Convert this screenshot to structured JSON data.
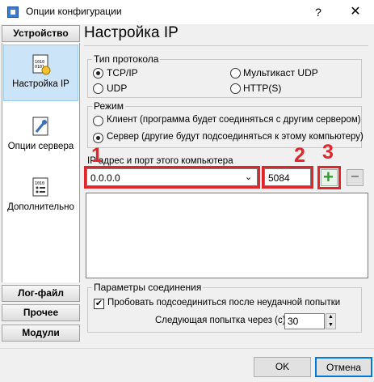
{
  "window": {
    "title": "Опции конфигурации",
    "help_glyph": "?",
    "close_glyph": "✕"
  },
  "left_panel": {
    "header_top": "Устройство",
    "items": [
      {
        "label": "Настройка IP",
        "icon": "ip-settings-icon",
        "selected": true
      },
      {
        "label": "Опции сервера",
        "icon": "server-options-icon",
        "selected": false
      },
      {
        "label": "Дополнительно",
        "icon": "additional-icon",
        "selected": false
      }
    ],
    "bottom_headers": [
      "Лог-файл",
      "Прочее",
      "Модули"
    ]
  },
  "main": {
    "title": "Настройка IP",
    "protocol_group": {
      "legend": "Тип протокола",
      "options": [
        "TCP/IP",
        "Мультикаст UDP",
        "UDP",
        "HTTP(S)"
      ],
      "selected": "TCP/IP"
    },
    "mode_group": {
      "legend": "Режим",
      "options": [
        "Клиент (программа будет соединяться с другим сервером)",
        "Сервер (другие будут подсоединяться к этому компьютеру)"
      ],
      "selected": 1
    },
    "address": {
      "label": "IP адрес и порт этого компьютера",
      "ip_value": "0.0.0.0",
      "port_value": "5084",
      "add_glyph": "+",
      "remove_glyph": "−"
    },
    "annotations": [
      "1",
      "2",
      "3"
    ],
    "connection_group": {
      "legend": "Параметры соединения",
      "retry_label": "Пробовать подсоединиться после неудачной попытки",
      "retry_checked": true,
      "next_try_label": "Следующая попытка через (с)",
      "next_try_value": "30"
    }
  },
  "footer": {
    "ok_label": "OK",
    "cancel_label": "Отмена"
  },
  "colors": {
    "accent_red": "#e0252b",
    "selection": "#cce4f7",
    "add_green": "#2e9e2e"
  }
}
